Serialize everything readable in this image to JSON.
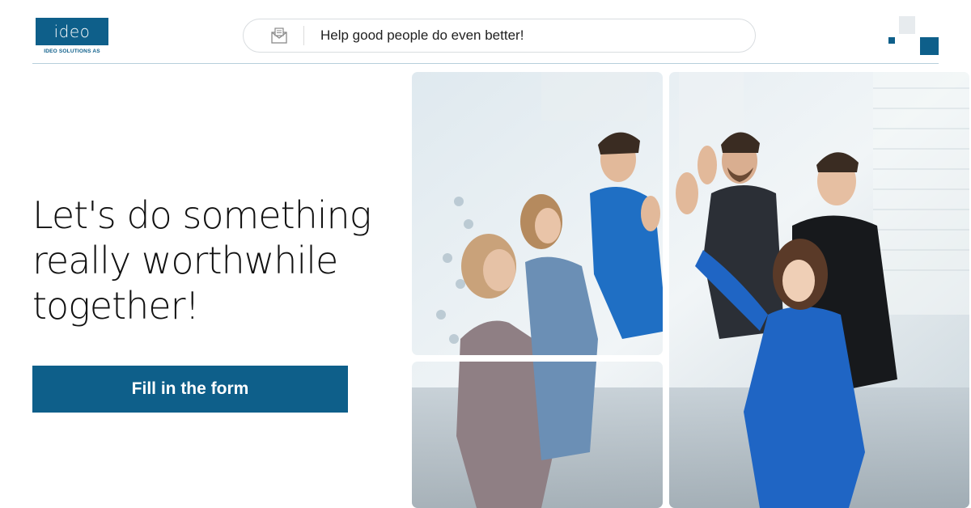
{
  "brand": {
    "logo_text": "ideo",
    "logo_subtitle": "IDEO SOLUTIONS AS",
    "color": "#0e5f8a"
  },
  "search": {
    "icon": "mail-icon",
    "text": "Help good people do even better!"
  },
  "hero": {
    "headline": "Let's do something really worthwhile together!",
    "cta_label": "Fill in the form"
  },
  "photo": {
    "icon": "team-photo"
  }
}
